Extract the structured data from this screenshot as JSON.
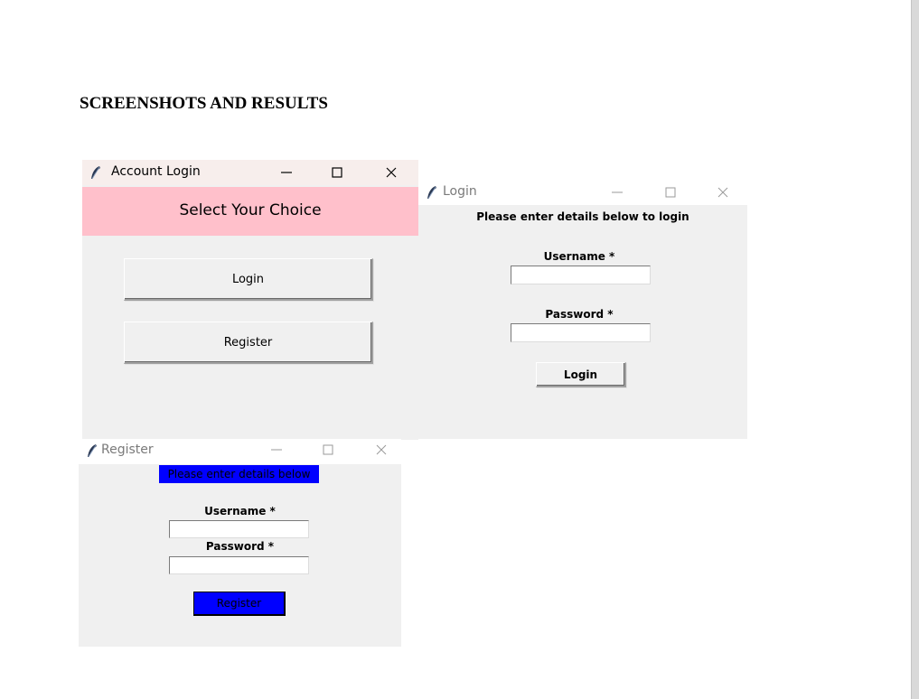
{
  "document": {
    "heading": "SCREENSHOTS AND RESULTS"
  },
  "account_window": {
    "title": "Account Login",
    "banner": "Select Your Choice",
    "banner_bg": "#ffc0cb",
    "login_button": "Login",
    "register_button": "Register"
  },
  "login_window": {
    "title": "Login",
    "prompt": "Please enter details below to login",
    "username_label": "Username *",
    "username_value": "",
    "password_label": "Password *",
    "password_value": "",
    "login_button": "Login"
  },
  "register_window": {
    "title": "Register",
    "prompt": "Please enter details below",
    "prompt_bg": "#0000ff",
    "username_label": "Username *",
    "username_value": "",
    "password_label": "Password *",
    "password_value": "",
    "register_button": "Register",
    "register_button_bg": "#0000ff"
  },
  "icons": {
    "app_icon": "feather-icon",
    "minimize": "minimize-icon",
    "maximize": "maximize-icon",
    "close": "close-icon"
  }
}
